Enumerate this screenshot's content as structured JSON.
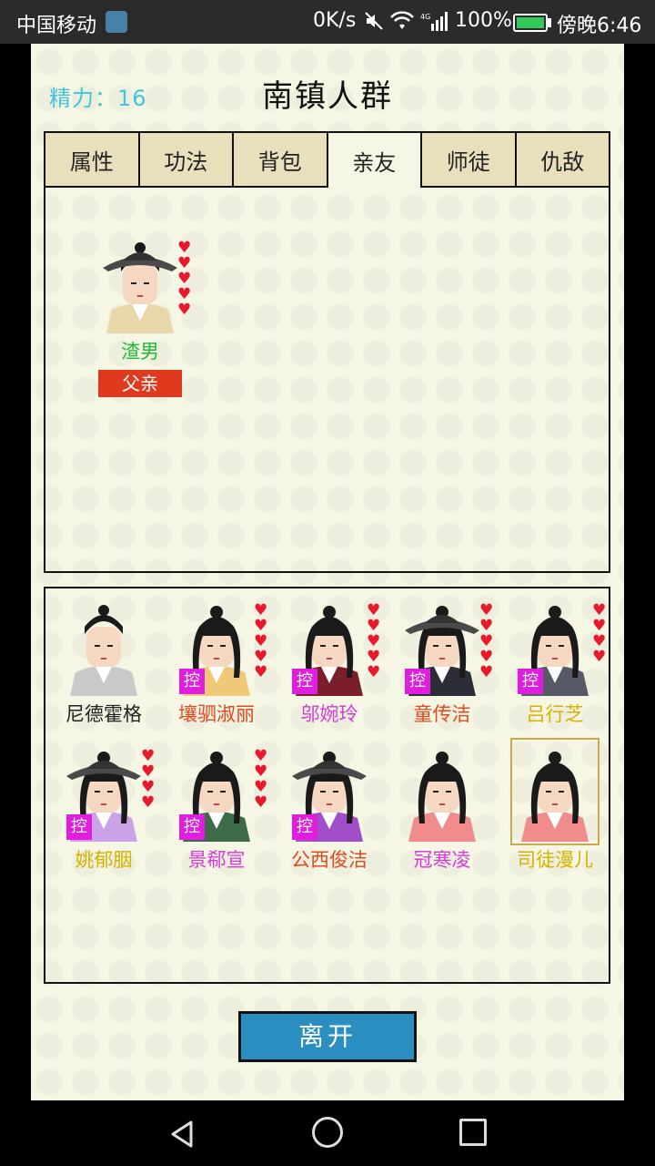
{
  "status_bar": {
    "carrier": "中国移动",
    "net_speed": "0K/s",
    "battery": "100%",
    "time": "傍晚6:46"
  },
  "header": {
    "energy": "精力：16",
    "title": "南镇人群"
  },
  "tabs": [
    {
      "label": "属性",
      "active": false
    },
    {
      "label": "功法",
      "active": false
    },
    {
      "label": "背包",
      "active": false
    },
    {
      "label": "亲友",
      "active": true
    },
    {
      "label": "师徒",
      "active": false
    },
    {
      "label": "仇敌",
      "active": false
    }
  ],
  "relatives": [
    {
      "name": "渣男",
      "relation": "父亲",
      "hearts": 5,
      "name_color": "#22b83a"
    }
  ],
  "crowd": [
    {
      "name": "尼德霍格",
      "hearts": 0,
      "controlled": false,
      "name_color": "#222222"
    },
    {
      "name": "壤驷淑丽",
      "hearts": 5,
      "controlled": true,
      "name_color": "#e04a1e"
    },
    {
      "name": "邬婉玲",
      "hearts": 5,
      "controlled": true,
      "name_color": "#d63cd6"
    },
    {
      "name": "童传洁",
      "hearts": 5,
      "controlled": true,
      "name_color": "#e04a1e"
    },
    {
      "name": "吕行芝",
      "hearts": 4,
      "controlled": true,
      "name_color": "#d4b400"
    },
    {
      "name": "姚郁胭",
      "hearts": 4,
      "controlled": true,
      "name_color": "#d4b400"
    },
    {
      "name": "景郗宣",
      "hearts": 4,
      "controlled": true,
      "name_color": "#d63cd6"
    },
    {
      "name": "公西俊洁",
      "hearts": 0,
      "controlled": true,
      "name_color": "#e04a1e"
    },
    {
      "name": "冠寒凌",
      "hearts": 0,
      "controlled": false,
      "name_color": "#d63cd6"
    },
    {
      "name": "司徒漫儿",
      "hearts": 0,
      "controlled": false,
      "name_color": "#d4b400",
      "selected": true
    }
  ],
  "control_badge": "控",
  "leave_button": "离开"
}
